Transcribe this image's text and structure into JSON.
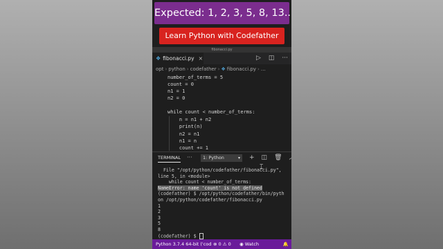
{
  "banner": {
    "expected": "Expected: 1, 2, 3, 5, 8, 13...",
    "subtitle": "Learn Python with Codefather",
    "expected_bg": "#7b2d8e",
    "subtitle_bg": "#d8231f"
  },
  "window": {
    "title": "fibonacci.py"
  },
  "tab": {
    "icon": "python-file-icon",
    "label": "fibonacci.py",
    "close": "×"
  },
  "tab_actions": {
    "run": "▷",
    "split": "◫",
    "more": "···"
  },
  "breadcrumb": {
    "items": [
      "opt",
      "python",
      "codefather"
    ],
    "file": "fibonacci.py",
    "separator": "›",
    "ellipsis": "…"
  },
  "code": {
    "lines": [
      "number_of_terms = 5",
      "count = 0",
      "n1 = 1",
      "n2 = 0",
      "",
      "while count < number_of_terms:",
      "    n = n1 + n2",
      "    print(n)",
      "    n2 = n1",
      "    n1 = n",
      "    count += 1"
    ]
  },
  "panel": {
    "title": "TERMINAL",
    "dots": "···",
    "terminal_select": "1: Python",
    "actions": {
      "add": "+",
      "split": "◫",
      "trash": "🗑",
      "chevron": "︿"
    }
  },
  "terminal": {
    "lines": [
      "  File \"/opt/python/codefather/fibonacci.py\",",
      "line 5, in <module>",
      "    while count < number_of_terms:",
      "NameError: name 'count' is not defined",
      "(codefather) $ /opt/python/codefather/bin/pyth",
      "on /opt/python/codefather/fibonacci.py",
      "1",
      "2",
      "3",
      "5",
      "8",
      "(codefather) $ "
    ],
    "highlight_index": 3
  },
  "statusbar": {
    "python": "Python 3.7.4 64-bit ('cod",
    "errors": "0",
    "warnings": "0",
    "watch": "Watch",
    "color": "#6a1b9a"
  }
}
